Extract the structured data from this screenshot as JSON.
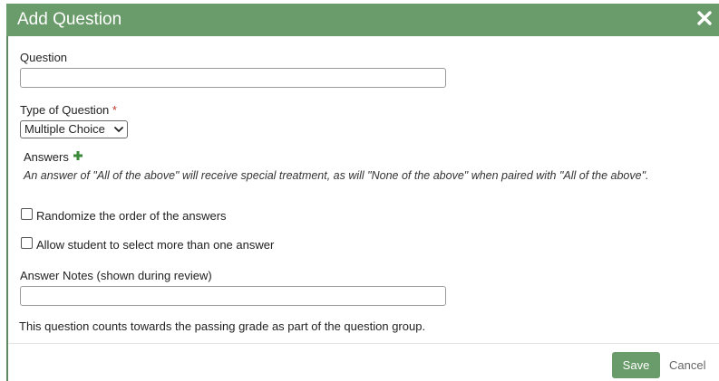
{
  "dialog": {
    "title": "Add Question"
  },
  "question": {
    "label": "Question",
    "value": ""
  },
  "type_of_question": {
    "label": "Type of Question",
    "required_marker": "*",
    "selected": "Multiple Choice"
  },
  "answers": {
    "label": "Answers",
    "hint": "An answer of \"All of the above\" will receive special treatment, as will \"None of the above\" when paired with \"All of the above\"."
  },
  "options": {
    "randomize_label": "Randomize the order of the answers",
    "randomize_checked": false,
    "multi_select_label": "Allow student to select more than one answer",
    "multi_select_checked": false
  },
  "answer_notes": {
    "label": "Answer Notes (shown during review)",
    "value": ""
  },
  "footer_note": "This question counts towards the passing grade as part of the question group.",
  "buttons": {
    "save": "Save",
    "cancel": "Cancel"
  },
  "colors": {
    "header": "#6a9b6a",
    "accent": "#3a8a3a",
    "required": "#c0392b"
  }
}
